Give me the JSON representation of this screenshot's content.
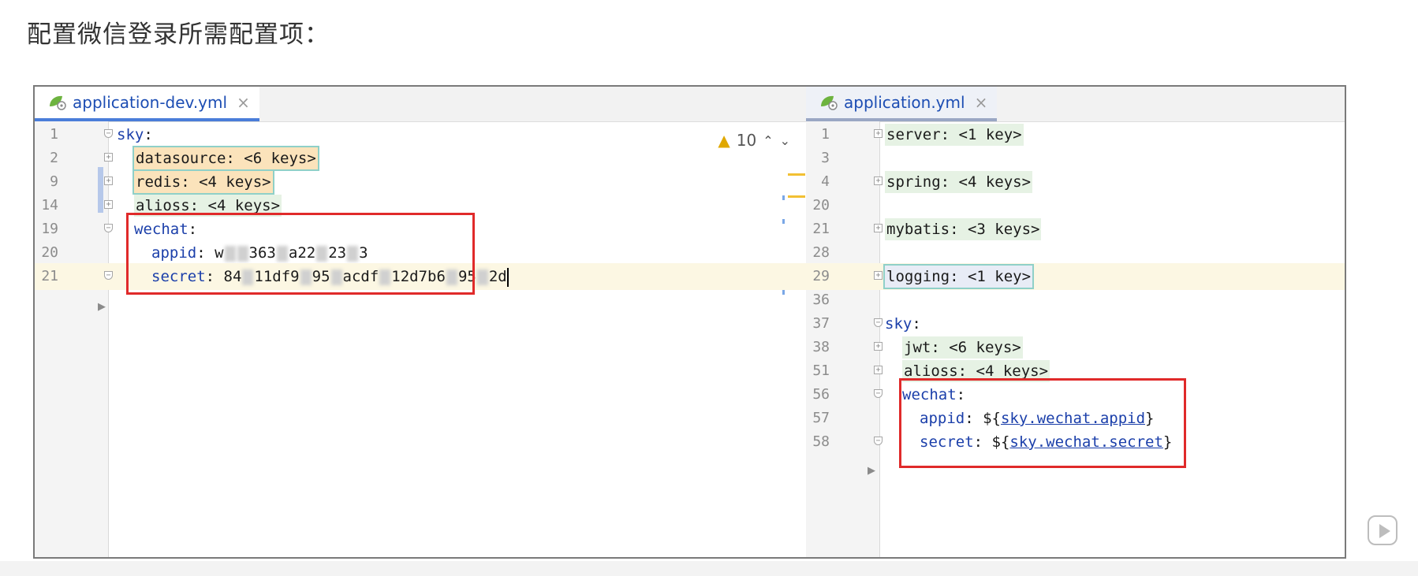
{
  "page": {
    "title": "配置微信登录所需配置项："
  },
  "left_editor": {
    "tab": {
      "label": "application-dev.yml",
      "close": "×",
      "icon": "spring-leaf-icon",
      "active": true
    },
    "warnings": {
      "count": "10",
      "icon": "warning-icon",
      "up": "⌃",
      "down": "⌄"
    },
    "lines": [
      {
        "n": "1",
        "key": "sky",
        "sep": ":",
        "rest": ""
      },
      {
        "n": "2",
        "key": "datasource",
        "sep": ": ",
        "rest": "<6 keys>"
      },
      {
        "n": "9",
        "key": "redis",
        "sep": ": ",
        "rest": "<4 keys>"
      },
      {
        "n": "14",
        "key": "alioss",
        "sep": ": ",
        "rest": "<4 keys>"
      },
      {
        "n": "19",
        "key": "wechat",
        "sep": ":",
        "rest": ""
      },
      {
        "n": "20",
        "key": "appid",
        "sep": ": ",
        "parts": [
          "w",
          "363",
          "a22",
          "23",
          "3"
        ]
      },
      {
        "n": "21",
        "key": "secret",
        "sep": ": ",
        "parts": [
          "84",
          "11df9",
          "95",
          "acdf",
          "12d",
          "7b6",
          "95",
          "2d"
        ]
      }
    ]
  },
  "right_editor": {
    "tab": {
      "label": "application.yml",
      "close": "×",
      "icon": "spring-leaf-icon",
      "active": false
    },
    "lines": [
      {
        "n": "1",
        "key": "server",
        "sep": ": ",
        "rest": "<1 key>"
      },
      {
        "n": "3",
        "key": "",
        "sep": "",
        "rest": ""
      },
      {
        "n": "4",
        "key": "spring",
        "sep": ": ",
        "rest": "<4 keys>"
      },
      {
        "n": "20",
        "key": "",
        "sep": "",
        "rest": ""
      },
      {
        "n": "21",
        "key": "mybatis",
        "sep": ": ",
        "rest": "<3 keys>"
      },
      {
        "n": "28",
        "key": "",
        "sep": "",
        "rest": ""
      },
      {
        "n": "29",
        "key": "logging",
        "sep": ": ",
        "rest": "<1 key>"
      },
      {
        "n": "36",
        "key": "",
        "sep": "",
        "rest": ""
      },
      {
        "n": "37",
        "key": "sky",
        "sep": ":",
        "rest": ""
      },
      {
        "n": "38",
        "key": "jwt",
        "sep": ": ",
        "rest": "<6 keys>"
      },
      {
        "n": "51",
        "key": "alioss",
        "sep": ": ",
        "rest": "<4 keys>"
      },
      {
        "n": "56",
        "key": "wechat",
        "sep": ":",
        "rest": ""
      },
      {
        "n": "57",
        "key": "appid",
        "sep": ": ",
        "prefix": "${",
        "ref": "sky.wechat.appid",
        "suffix": "}"
      },
      {
        "n": "58",
        "key": "secret",
        "sep": ": ",
        "prefix": "${",
        "ref": "sky.wechat.secret",
        "suffix": "}"
      }
    ]
  },
  "colors": {
    "highlight_box": "#e02a2a",
    "key": "#1b3faa",
    "folded_chip": "#e6f2e4",
    "warning_chip": "#fbe3bb",
    "current_line": "#fcf7e3"
  },
  "overlay": {
    "icon": "play-video-icon"
  }
}
